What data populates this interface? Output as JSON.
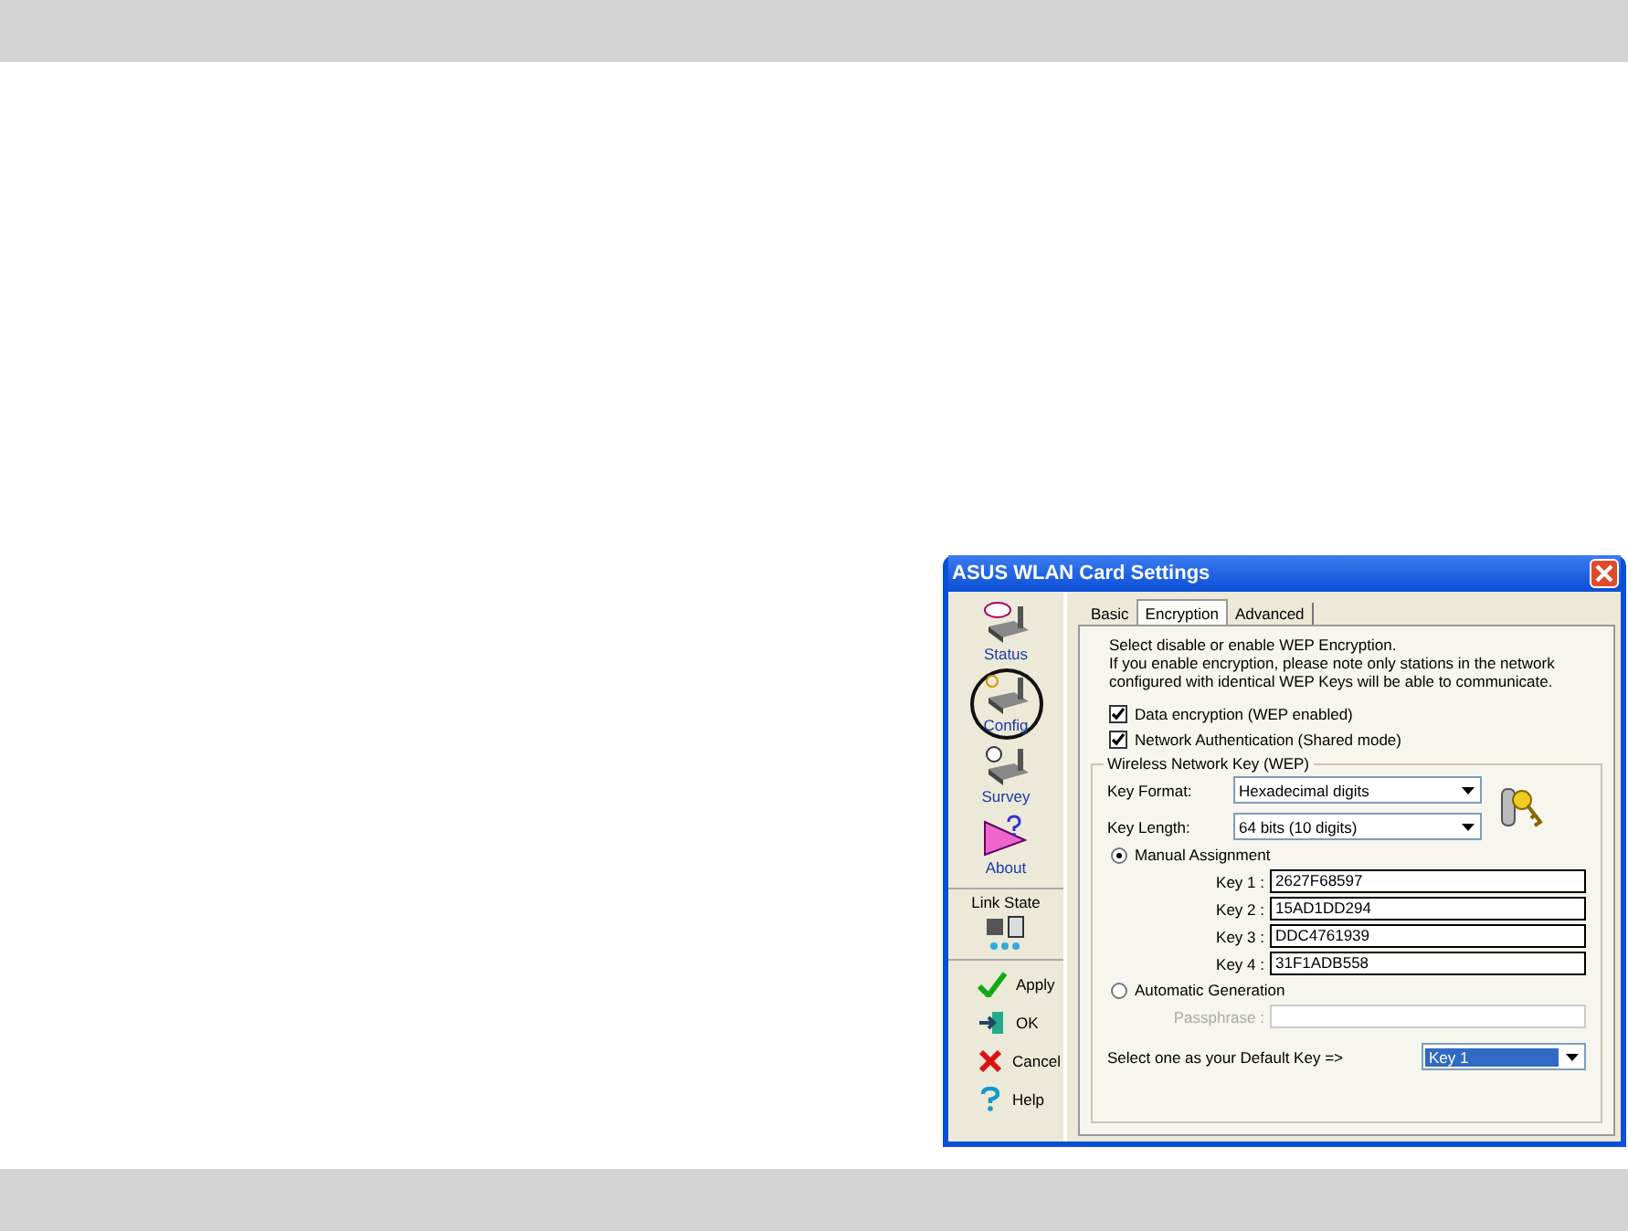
{
  "window": {
    "title": "ASUS WLAN Card Settings"
  },
  "sidebar": {
    "nav": [
      {
        "label": "Status",
        "kind": "status",
        "selected": false
      },
      {
        "label": "Config",
        "kind": "config",
        "selected": true
      },
      {
        "label": "Survey",
        "kind": "survey",
        "selected": false
      },
      {
        "label": "About",
        "kind": "about",
        "selected": false
      }
    ],
    "link_state": {
      "label": "Link State"
    },
    "buttons": [
      {
        "label": "Apply",
        "kind": "apply"
      },
      {
        "label": "OK",
        "kind": "ok"
      },
      {
        "label": "Cancel",
        "kind": "cancel"
      },
      {
        "label": "Help",
        "kind": "help"
      }
    ]
  },
  "tabs": [
    {
      "label": "Basic",
      "selected": false
    },
    {
      "label": "Encryption",
      "selected": true
    },
    {
      "label": "Advanced",
      "selected": false
    }
  ],
  "intro": [
    "Select disable or enable WEP Encryption.",
    "If you enable encryption, please note only stations in the network configured with identical WEP Keys will be able to communicate."
  ],
  "checkboxes": [
    {
      "label": "Data encryption (WEP enabled)",
      "checked": true
    },
    {
      "label": "Network Authentication (Shared mode)",
      "checked": true
    }
  ],
  "key_group": {
    "title": "Wireless Network Key (WEP)",
    "dropdowns": [
      {
        "label": "Key Format:",
        "value": "Hexadecimal digits"
      },
      {
        "label": "Key Length:",
        "value": "64 bits (10 digits)"
      }
    ],
    "manual": {
      "label": "Manual Assignment",
      "selected": true
    },
    "keys": [
      {
        "label": "Key 1 :",
        "value": "2627F68597"
      },
      {
        "label": "Key 2 :",
        "value": "15AD1DD294"
      },
      {
        "label": "Key 3 :",
        "value": "DDC4761939"
      },
      {
        "label": "Key 4 :",
        "value": "31F1ADB558"
      }
    ],
    "automatic": {
      "label": "Automatic Generation",
      "selected": false
    },
    "passphrase": {
      "label": "Passphrase :",
      "disabled": true
    },
    "default_key": {
      "label": "Select one as your Default Key =>",
      "value": "Key 1"
    }
  }
}
